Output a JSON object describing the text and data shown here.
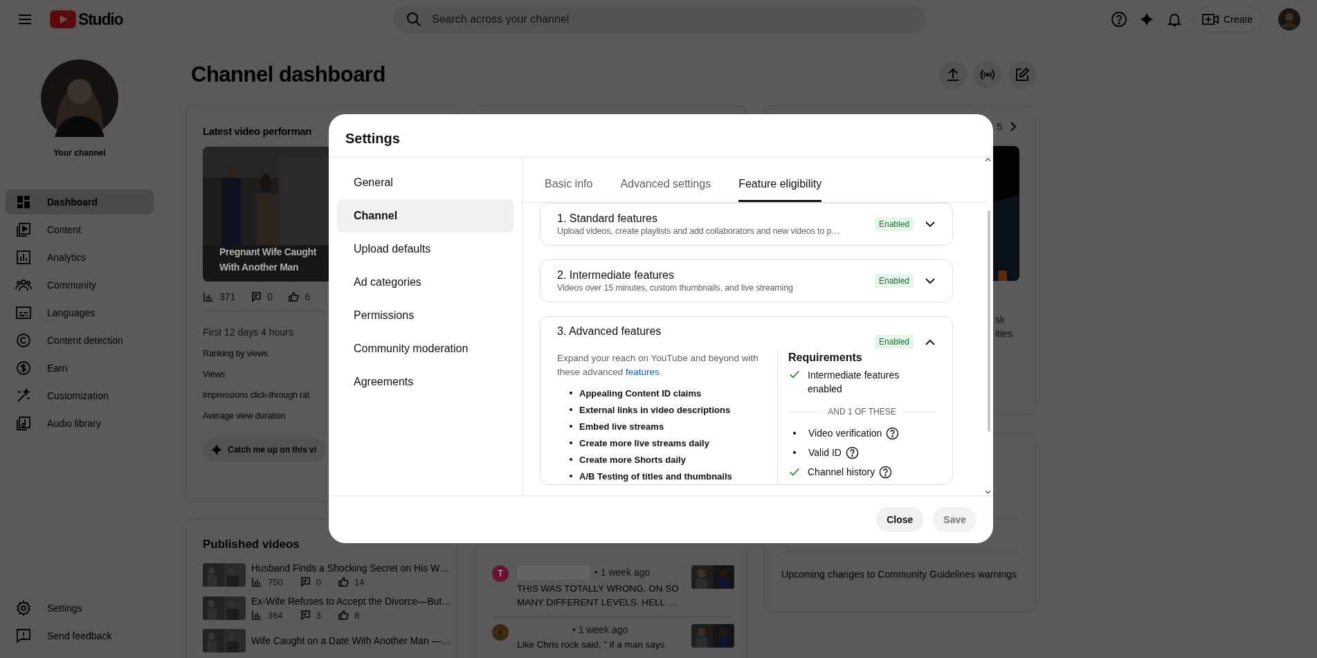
{
  "topbar": {
    "logo_text": "Studio",
    "search_placeholder": "Search across your channel",
    "create_label": "Create"
  },
  "sidebar": {
    "channel_label": "Your channel",
    "items": [
      {
        "label": "Dashboard",
        "selected": true
      },
      {
        "label": "Content",
        "selected": false
      },
      {
        "label": "Analytics",
        "selected": false
      },
      {
        "label": "Community",
        "selected": false
      },
      {
        "label": "Languages",
        "selected": false
      },
      {
        "label": "Content detection",
        "selected": false
      },
      {
        "label": "Earn",
        "selected": false
      },
      {
        "label": "Customization",
        "selected": false
      },
      {
        "label": "Audio library",
        "selected": false
      }
    ],
    "footer_items": [
      {
        "label": "Settings"
      },
      {
        "label": "Send feedback"
      }
    ]
  },
  "page": {
    "title": "Channel dashboard"
  },
  "latest_video": {
    "title": "Latest video performan",
    "caption": [
      "Pregnant Wife Caught",
      "With Another Man"
    ],
    "views": "371",
    "comments": "0",
    "likes": "6",
    "period": "First 12 days 4 hours",
    "metrics": [
      "Ranking by views",
      "Views",
      "Impressions click-through rat",
      "Average view duration"
    ],
    "ai_button": "Catch me up on this vi"
  },
  "published_videos": {
    "title": "Published videos",
    "videos": [
      {
        "title": "Husband Finds a Shocking Secret on His W…",
        "views": "750",
        "comments": "0",
        "likes": "14"
      },
      {
        "title": "Ex-Wife Refuses to Accept the Divorce—But…",
        "views": "364",
        "comments": "3",
        "likes": "8"
      },
      {
        "title": "Wife Caught on a Date With Another Man —…"
      }
    ]
  },
  "comments": {
    "items": [
      {
        "kind": "letter",
        "avatar_letter": "T",
        "name_redacted": true,
        "time": "• 1 week ago",
        "text": "THIS WAS TOTALLY WRONG. ON SO MANY DIFFERENT LEVELS. HELL …"
      },
      {
        "kind": "picture",
        "name_redacted": false,
        "time": "• 1 week ago",
        "text": "Like Chris rock said, \" if a man says"
      }
    ]
  },
  "right_card": {
    "page_indicator": "5",
    "fragments": [
      "sk",
      "ities"
    ]
  },
  "news_card": {
    "text": "Upcoming changes to Community Guidelines warnings"
  },
  "settings_dialog": {
    "title": "Settings",
    "nav": [
      {
        "label": "General",
        "selected": false
      },
      {
        "label": "Channel",
        "selected": true
      },
      {
        "label": "Upload defaults",
        "selected": false
      },
      {
        "label": "Ad categories",
        "selected": false
      },
      {
        "label": "Permissions",
        "selected": false
      },
      {
        "label": "Community moderation",
        "selected": false
      },
      {
        "label": "Agreements",
        "selected": false
      }
    ],
    "tabs": [
      {
        "label": "Basic info",
        "selected": false
      },
      {
        "label": "Advanced settings",
        "selected": false
      },
      {
        "label": "Feature eligibility",
        "selected": true
      }
    ],
    "sections": [
      {
        "title": "1. Standard features",
        "subtitle": "Upload videos, create playlists and add collaborators and new videos to p…",
        "status": "Enabled",
        "expanded": false
      },
      {
        "title": "2. Intermediate features",
        "subtitle": "Videos over 15 minutes, custom thumbnails, and live streaming",
        "status": "Enabled",
        "expanded": false
      },
      {
        "title": "3. Advanced features",
        "status": "Enabled",
        "expanded": true,
        "intro": "Expand your reach on YouTube and beyond with these advanced ",
        "intro_link": "features",
        "intro_end": ".",
        "features": [
          "Appealing Content ID claims",
          "External links in video descriptions",
          "Embed live streams",
          "Create more live streams daily",
          "Create more Shorts daily",
          "A/B Testing of titles and thumbnails"
        ],
        "requirements_title": "Requirements",
        "requirements": [
          {
            "label": "Intermediate features enabled",
            "met": true
          }
        ],
        "divider": "AND 1 OF THESE",
        "options": [
          {
            "label": "Video verification",
            "met": false
          },
          {
            "label": "Valid ID",
            "met": false
          },
          {
            "label": "Channel history",
            "met": true
          }
        ]
      }
    ],
    "buttons": [
      {
        "label": "Close",
        "disabled": false
      },
      {
        "label": "Save",
        "disabled": true
      }
    ]
  }
}
